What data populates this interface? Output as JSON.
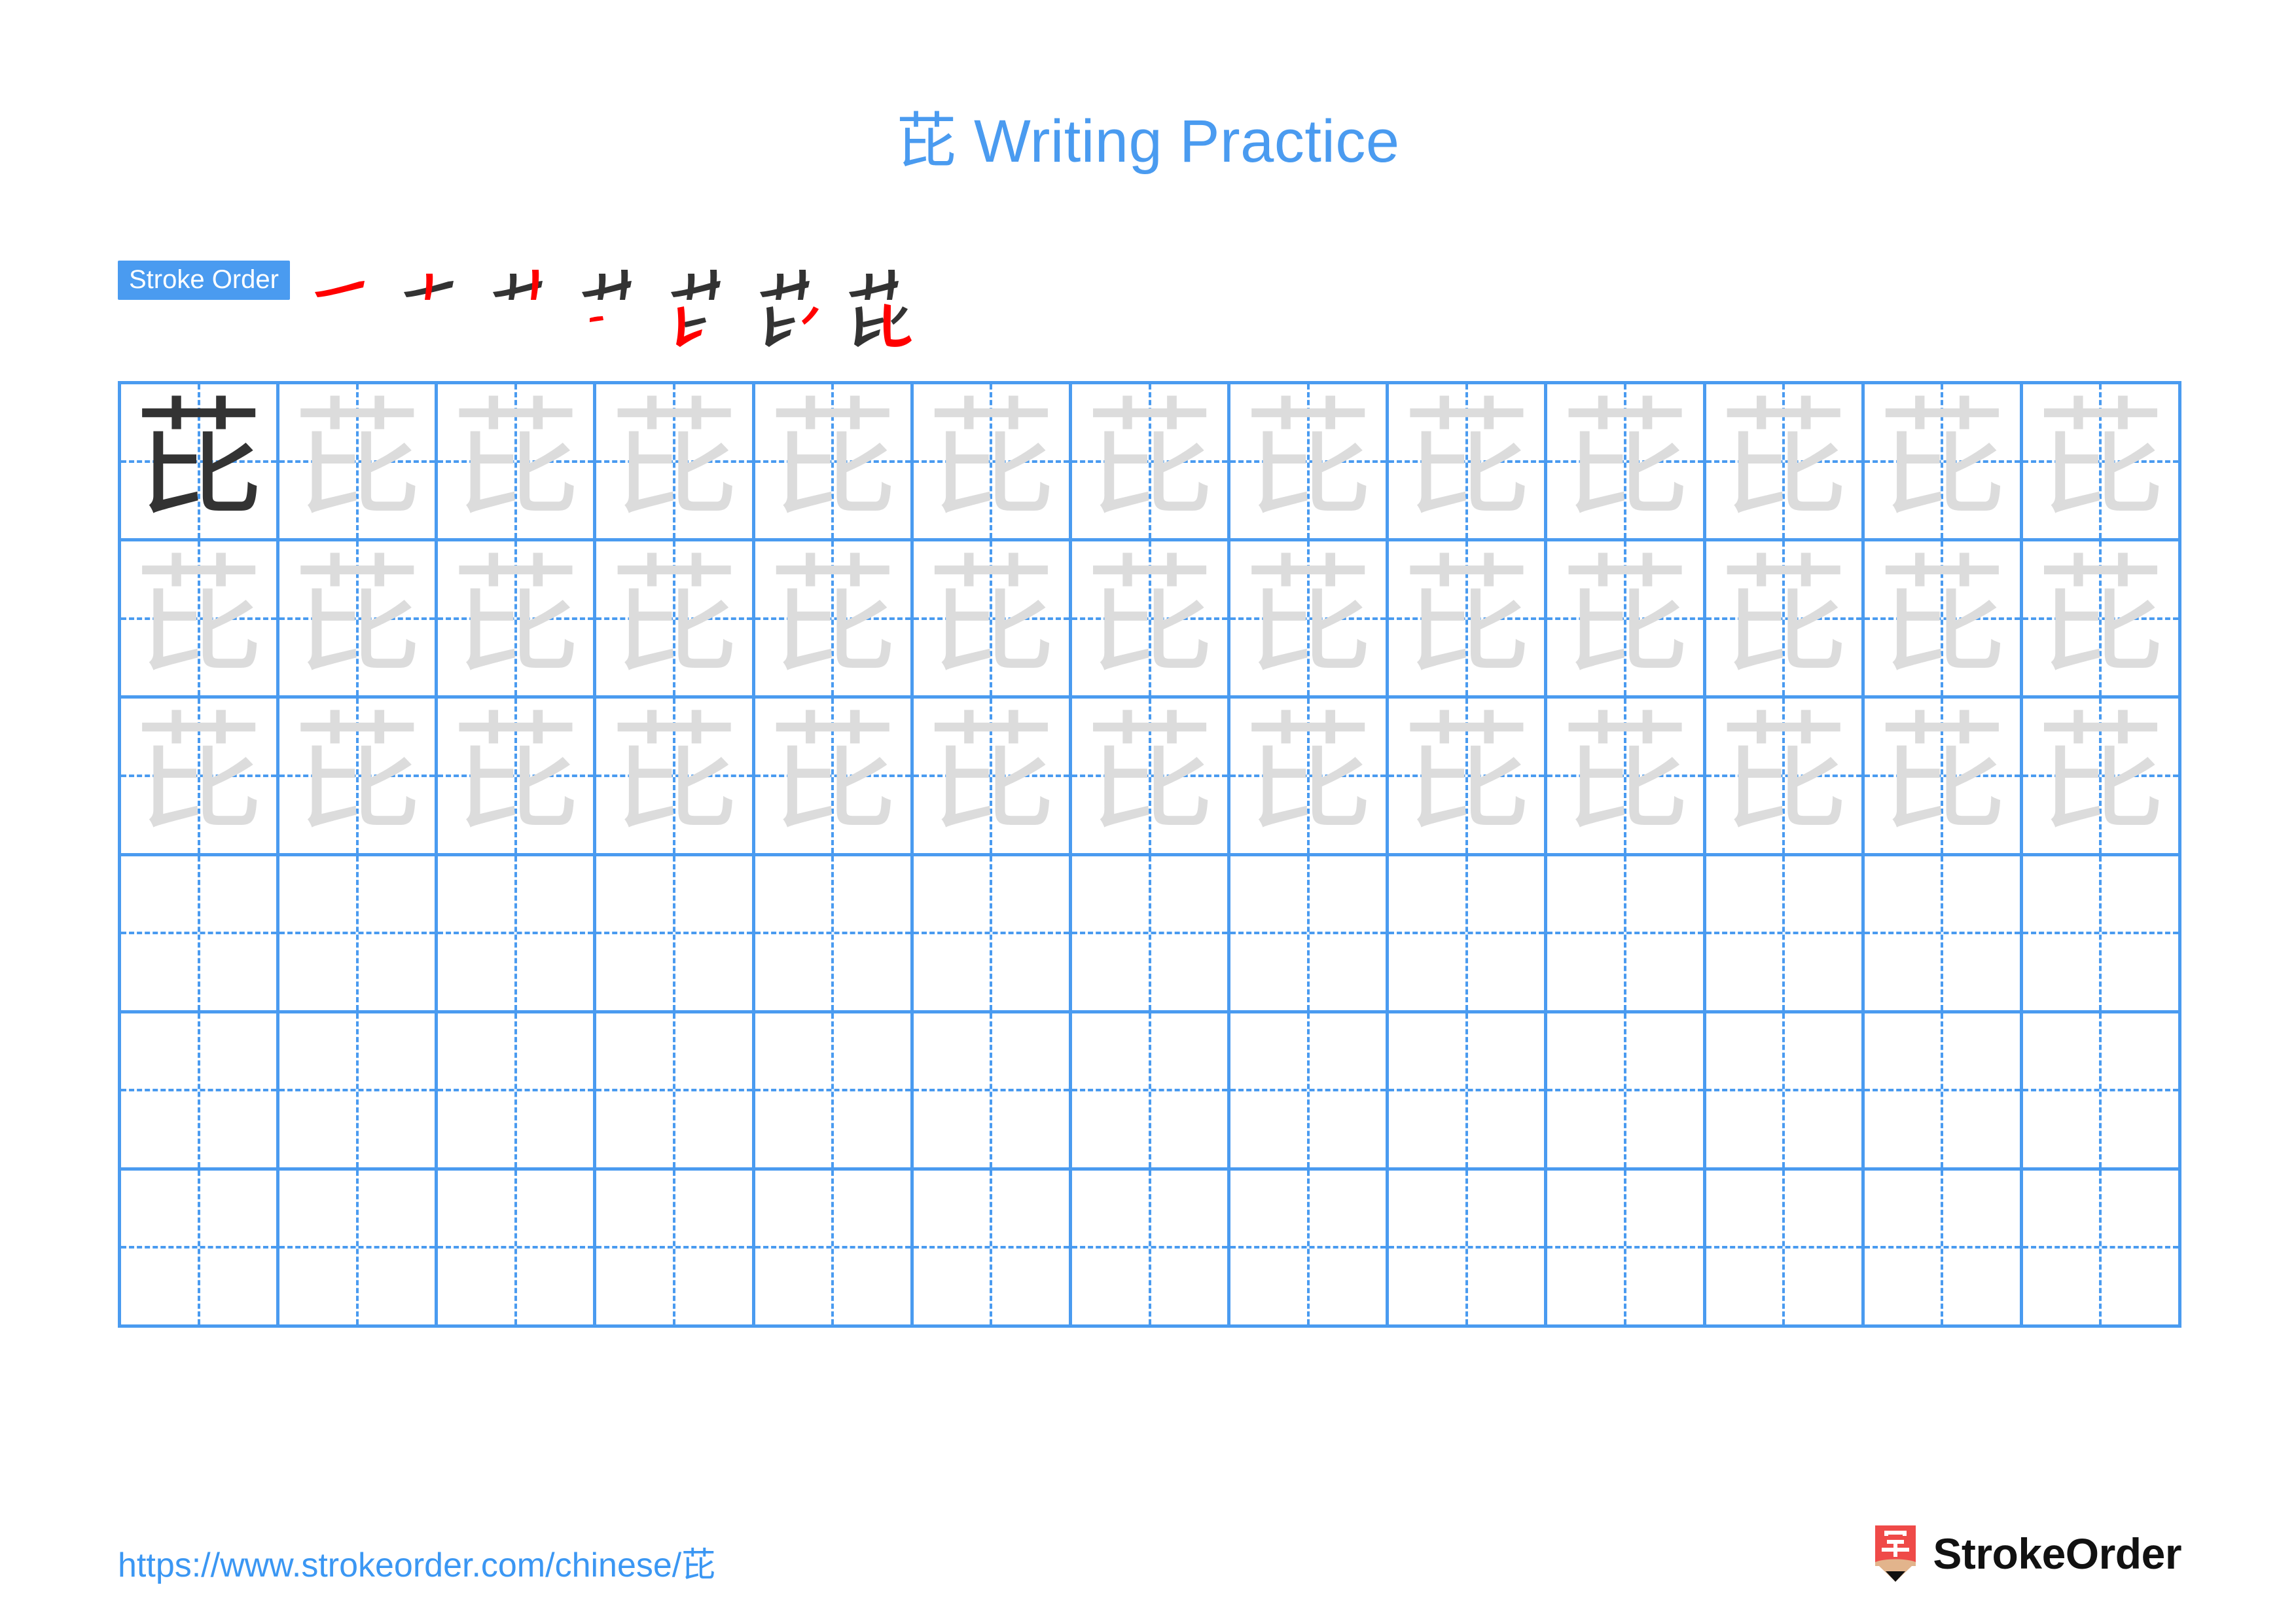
{
  "page": {
    "character": "芘",
    "background_color": "#ffffff",
    "accent_color": "#4a9bf0",
    "stroke_highlight_color": "#ff0000",
    "stroke_done_color": "#333333",
    "trace_color": "#dcdcdc"
  },
  "header": {
    "title": "芘 Writing Practice",
    "title_color": "#4a9bf0"
  },
  "stroke_order": {
    "badge_label": "Stroke Order",
    "badge_bg": "#4a9bf0",
    "badge_text_color": "#ffffff",
    "total_strokes": 7,
    "steps": [
      {
        "index": 1,
        "new_stroke": "héng (横) — top horizontal of 艹"
      },
      {
        "index": 2,
        "new_stroke": "shù (竖) — left vertical of 艹"
      },
      {
        "index": 3,
        "new_stroke": "shù (竖) — right vertical of 艹"
      },
      {
        "index": 4,
        "new_stroke": "héng (横) — short horizontal of 比 left"
      },
      {
        "index": 5,
        "new_stroke": "shù-tí (竖提) — left vertical rising of 比"
      },
      {
        "index": 6,
        "new_stroke": "piě (撇) — right slanting stroke of 比"
      },
      {
        "index": 7,
        "new_stroke": "shù-wān-gōu (竖弯钩) — final hook of 比"
      }
    ]
  },
  "practice_grid": {
    "columns": 13,
    "rows": 6,
    "border_color": "#4a9bf0",
    "guide_style": "dashed-crosshair",
    "cells": [
      [
        "dark",
        "light",
        "light",
        "light",
        "light",
        "light",
        "light",
        "light",
        "light",
        "light",
        "light",
        "light",
        "light"
      ],
      [
        "light",
        "light",
        "light",
        "light",
        "light",
        "light",
        "light",
        "light",
        "light",
        "light",
        "light",
        "light",
        "light"
      ],
      [
        "light",
        "light",
        "light",
        "light",
        "light",
        "light",
        "light",
        "light",
        "light",
        "light",
        "light",
        "light",
        "light"
      ],
      [
        "empty",
        "empty",
        "empty",
        "empty",
        "empty",
        "empty",
        "empty",
        "empty",
        "empty",
        "empty",
        "empty",
        "empty",
        "empty"
      ],
      [
        "empty",
        "empty",
        "empty",
        "empty",
        "empty",
        "empty",
        "empty",
        "empty",
        "empty",
        "empty",
        "empty",
        "empty",
        "empty"
      ],
      [
        "empty",
        "empty",
        "empty",
        "empty",
        "empty",
        "empty",
        "empty",
        "empty",
        "empty",
        "empty",
        "empty",
        "empty",
        "empty"
      ]
    ]
  },
  "footer": {
    "url": "https://www.strokeorder.com/chinese/芘",
    "url_color": "#3b97f3",
    "brand_name": "StrokeOrder",
    "logo_character": "字",
    "logo_color": "#ef4a48"
  }
}
